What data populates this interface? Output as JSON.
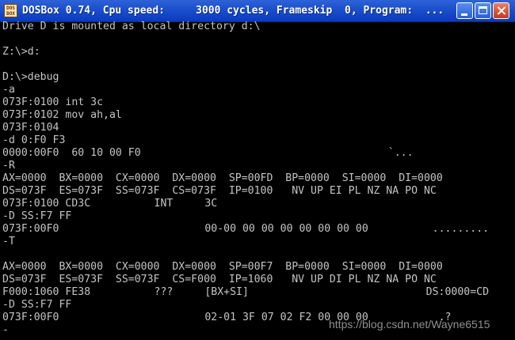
{
  "window": {
    "title": "DOSBox 0.74, Cpu speed:     3000 cycles, Frameskip  0, Program:  ...",
    "icon_label": "DOS BOX",
    "buttons": [
      "minimize-icon",
      "maximize-icon",
      "close-icon"
    ],
    "title_bar_color": "#1b4fcb",
    "close_button_color": "#c5371a"
  },
  "console": {
    "text_color": "#c4c4c4",
    "background": "#000000",
    "lines": [
      {
        "segments": [
          {
            "col": 0,
            "text": "Drive D is mounted as local directory d:\\"
          }
        ]
      },
      {
        "segments": []
      },
      {
        "segments": [
          {
            "col": 0,
            "text": "Z:\\>d:"
          }
        ]
      },
      {
        "segments": []
      },
      {
        "segments": [
          {
            "col": 0,
            "text": "D:\\>debug"
          }
        ]
      },
      {
        "segments": [
          {
            "col": 0,
            "text": "-a"
          }
        ]
      },
      {
        "segments": [
          {
            "col": 0,
            "text": "073F:0100 int 3c"
          }
        ]
      },
      {
        "segments": [
          {
            "col": 0,
            "text": "073F:0102 mov ah,al"
          }
        ]
      },
      {
        "segments": [
          {
            "col": 0,
            "text": "073F:0104"
          }
        ]
      },
      {
        "segments": [
          {
            "col": 0,
            "text": "-d 0:F0 F3"
          }
        ]
      },
      {
        "segments": [
          {
            "col": 0,
            "text": "0000:00F0  60 10 00 F0"
          },
          {
            "col": 61,
            "text": "`..."
          }
        ]
      },
      {
        "segments": [
          {
            "col": 0,
            "text": "-R"
          }
        ]
      },
      {
        "segments": [
          {
            "col": 0,
            "text": "AX=0000  BX=0000  CX=0000  DX=0000  SP=00FD  BP=0000  SI=0000  DI=0000"
          }
        ]
      },
      {
        "segments": [
          {
            "col": 0,
            "text": "DS=073F  ES=073F  SS=073F  CS=073F  IP=0100   NV UP EI PL NZ NA PO NC"
          }
        ]
      },
      {
        "segments": [
          {
            "col": 0,
            "text": "073F:0100 CD3C"
          },
          {
            "col": 24,
            "text": "INT"
          },
          {
            "col": 32,
            "text": "3C"
          }
        ]
      },
      {
        "segments": [
          {
            "col": 0,
            "text": "-D SS:F7 FF"
          }
        ]
      },
      {
        "segments": [
          {
            "col": 0,
            "text": "073F:00F0"
          },
          {
            "col": 32,
            "text": "00-00 00 00 00 00 00 00 00"
          },
          {
            "col": 68,
            "text": "........."
          }
        ]
      },
      {
        "segments": [
          {
            "col": 0,
            "text": "-T"
          }
        ]
      },
      {
        "segments": []
      },
      {
        "segments": [
          {
            "col": 0,
            "text": "AX=0000  BX=0000  CX=0000  DX=0000  SP=00F7  BP=0000  SI=0000  DI=0000"
          }
        ]
      },
      {
        "segments": [
          {
            "col": 0,
            "text": "DS=073F  ES=073F  SS=073F  CS=F000  IP=1060   NV UP DI PL NZ NA PO NC"
          }
        ]
      },
      {
        "segments": [
          {
            "col": 0,
            "text": "F000:1060 FE38"
          },
          {
            "col": 24,
            "text": "???"
          },
          {
            "col": 32,
            "text": "[BX+SI]"
          },
          {
            "col": 67,
            "text": "DS:0000=CD"
          }
        ]
      },
      {
        "segments": [
          {
            "col": 0,
            "text": "-D SS:F7 FF"
          }
        ]
      },
      {
        "segments": [
          {
            "col": 0,
            "text": "073F:00F0"
          },
          {
            "col": 32,
            "text": "02-01 3F 07 02 F2 00 00 00"
          },
          {
            "col": 69,
            "text": ".?"
          }
        ]
      },
      {
        "segments": [
          {
            "col": 0,
            "text": "-"
          }
        ]
      }
    ]
  },
  "watermark": "https://blog.csdn.net/Wayne6515"
}
